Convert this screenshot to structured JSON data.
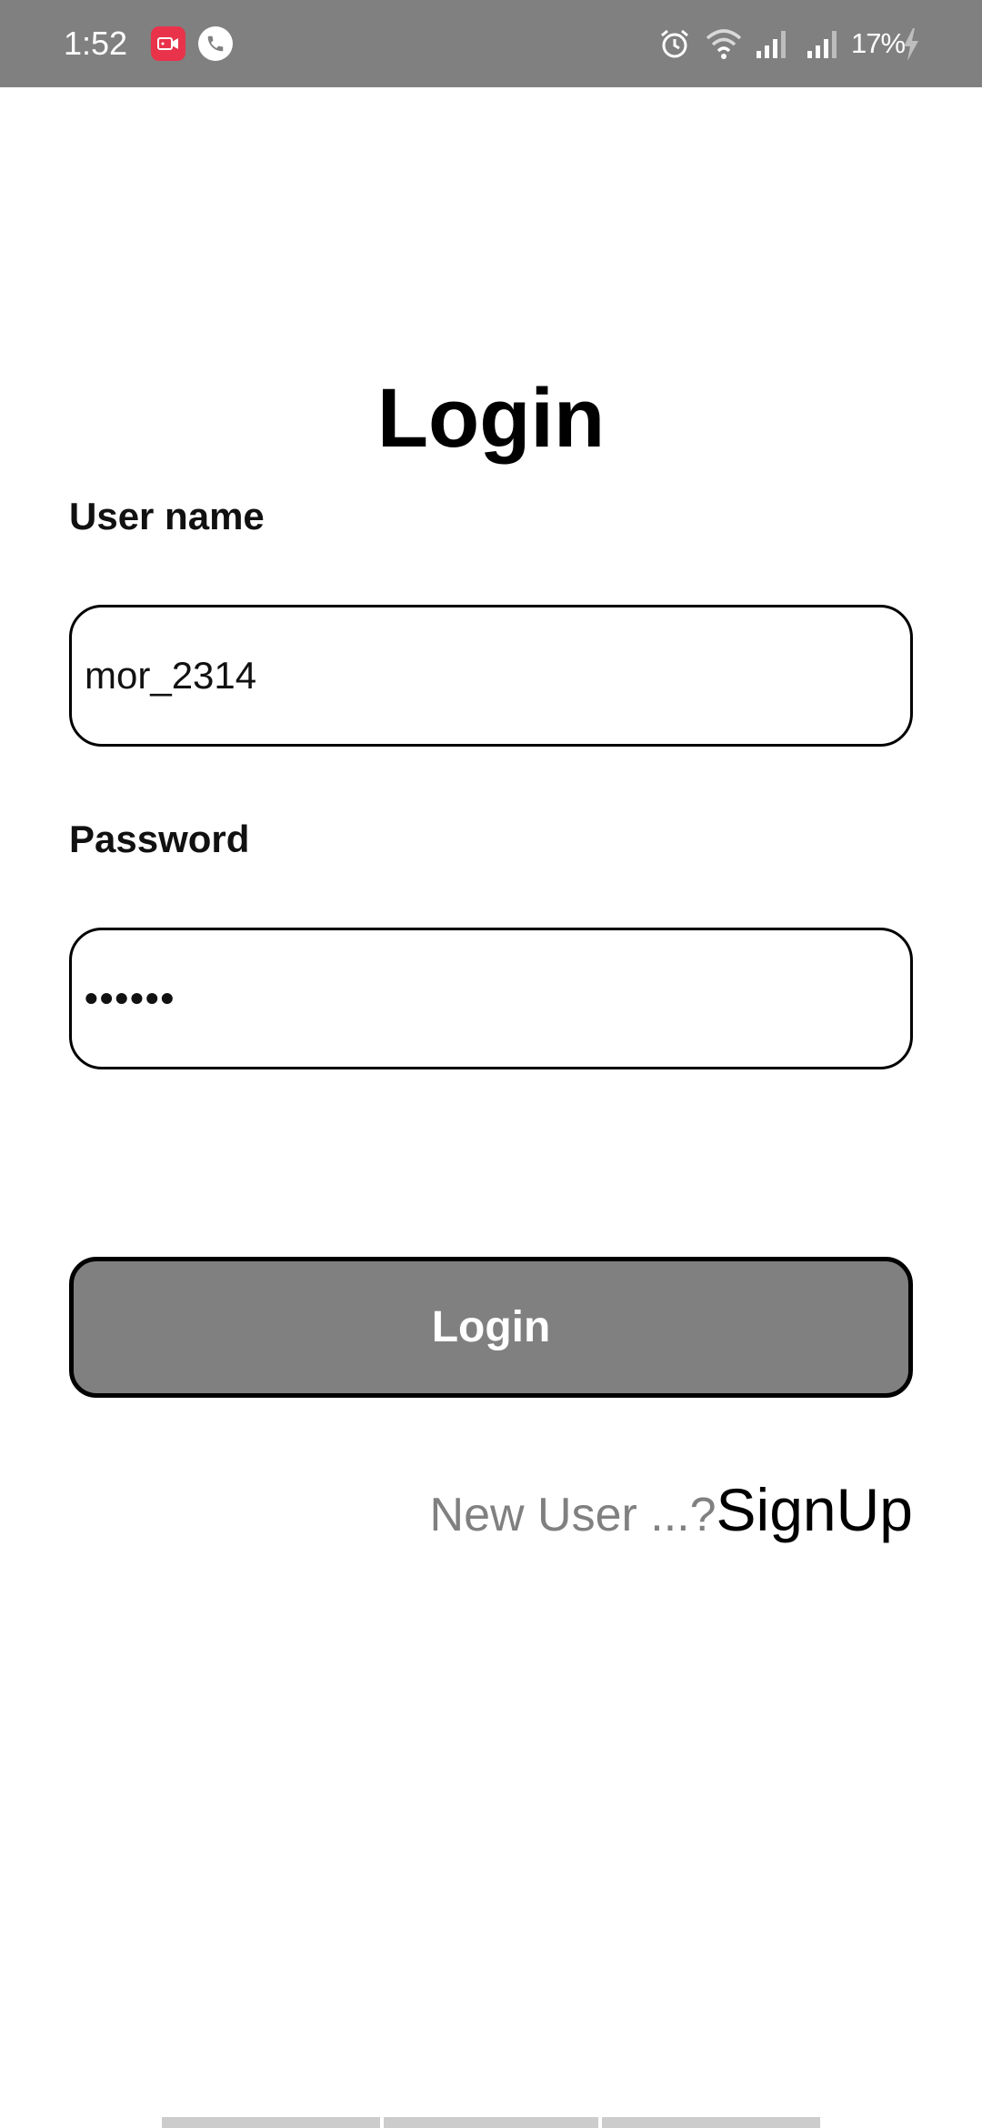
{
  "status_bar": {
    "time": "1:52",
    "battery_percent": "17%",
    "icons": [
      "screen-recorder-icon",
      "phone-call-icon",
      "alarm-icon",
      "wifi-icon",
      "signal-icon",
      "signal-icon",
      "charging-icon"
    ],
    "recorder_color": "#e8334a",
    "background": "#808080"
  },
  "page": {
    "title": "Login"
  },
  "form": {
    "username_label": "User name",
    "username_value": "mor_2314",
    "password_label": "Password",
    "password_value": "••••••",
    "login_button_label": "Login",
    "button_color": "#808080"
  },
  "signup": {
    "prompt": "New User ...?",
    "link_label": "SignUp"
  }
}
